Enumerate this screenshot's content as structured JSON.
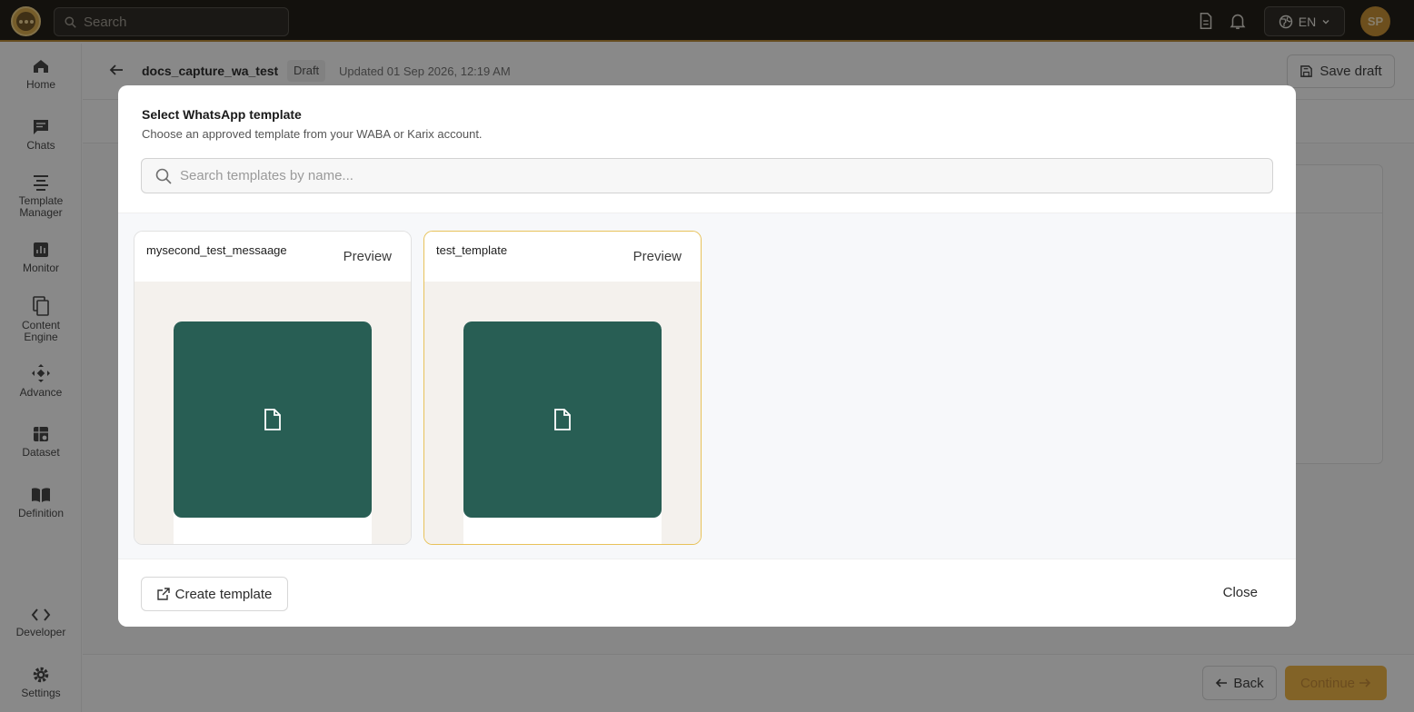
{
  "topbar": {
    "search_placeholder": "Search",
    "language": "EN",
    "avatar_initials": "SP"
  },
  "sidebar": {
    "items": [
      {
        "label": "Home",
        "icon": "home-icon"
      },
      {
        "label": "Chats",
        "icon": "chat-icon"
      },
      {
        "label": "Template Manager",
        "icon": "template-icon"
      },
      {
        "label": "Monitor",
        "icon": "monitor-icon"
      },
      {
        "label": "Content Engine",
        "icon": "copy-icon"
      },
      {
        "label": "Advance",
        "icon": "move-icon"
      },
      {
        "label": "Dataset",
        "icon": "dataset-icon"
      },
      {
        "label": "Definition",
        "icon": "book-icon"
      },
      {
        "label": "Developer",
        "icon": "code-icon"
      },
      {
        "label": "Settings",
        "icon": "gear-icon"
      }
    ]
  },
  "page": {
    "title": "docs_capture_wa_test",
    "status_badge": "Draft",
    "updated": "Updated 01 Sep 2026, 12:19 AM",
    "save_draft_label": "Save draft",
    "back_label": "Back",
    "continue_label": "Continue"
  },
  "modal": {
    "title": "Select WhatsApp template",
    "subtitle": "Choose an approved template from your WABA or Karix account.",
    "search_placeholder": "Search templates by name...",
    "templates": [
      {
        "name": "mysecond_test_messaage",
        "preview_label": "Preview",
        "selected": false
      },
      {
        "name": "test_template",
        "preview_label": "Preview",
        "selected": true
      }
    ],
    "create_label": "Create template",
    "close_label": "Close"
  },
  "colors": {
    "accent": "#f0b23a",
    "topbar": "#120e07",
    "media_green": "#285e54",
    "selected_border": "#e8c25a"
  }
}
